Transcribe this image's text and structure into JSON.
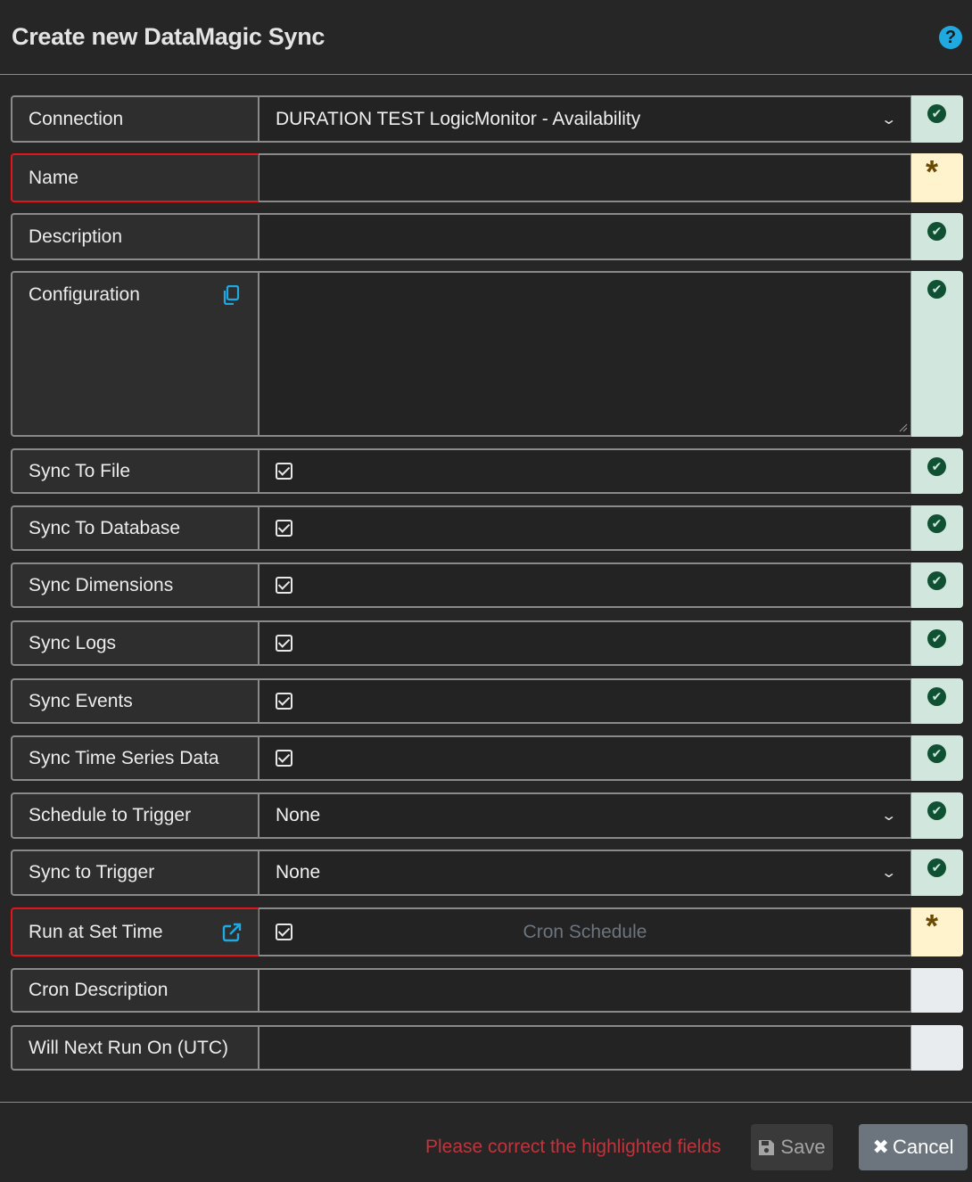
{
  "header": {
    "title": "Create new DataMagic Sync",
    "help_icon": "?"
  },
  "rows": {
    "connection": {
      "label": "Connection",
      "value": "DURATION TEST LogicMonitor - Availability"
    },
    "name": {
      "label": "Name",
      "value": ""
    },
    "description": {
      "label": "Description",
      "value": ""
    },
    "configuration": {
      "label": "Configuration",
      "value": ""
    },
    "sync_to_file": {
      "label": "Sync To File",
      "checked": true
    },
    "sync_to_database": {
      "label": "Sync To Database",
      "checked": true
    },
    "sync_dimensions": {
      "label": "Sync Dimensions",
      "checked": true
    },
    "sync_logs": {
      "label": "Sync Logs",
      "checked": true
    },
    "sync_events": {
      "label": "Sync Events",
      "checked": true
    },
    "sync_time_series": {
      "label": "Sync Time Series Data",
      "checked": true
    },
    "schedule_to_trigger": {
      "label": "Schedule to Trigger",
      "value": "None"
    },
    "sync_to_trigger": {
      "label": "Sync to Trigger",
      "value": "None"
    },
    "run_at_set_time": {
      "label": "Run at Set Time",
      "checked": true,
      "placeholder": "Cron Schedule"
    },
    "cron_description": {
      "label": "Cron Description",
      "value": ""
    },
    "will_next_run_on": {
      "label": "Will Next Run On (UTC)",
      "value": ""
    }
  },
  "status_icons": {
    "ok": "✔",
    "required": "*"
  },
  "footer": {
    "error_message": "Please correct the highlighted fields",
    "save_label": "Save",
    "cancel_label": "Cancel"
  },
  "colors": {
    "accent": "#1fa9e0",
    "error": "#e0161b",
    "ok_bg": "#d1e7dd",
    "required_bg": "#fff3cd"
  }
}
